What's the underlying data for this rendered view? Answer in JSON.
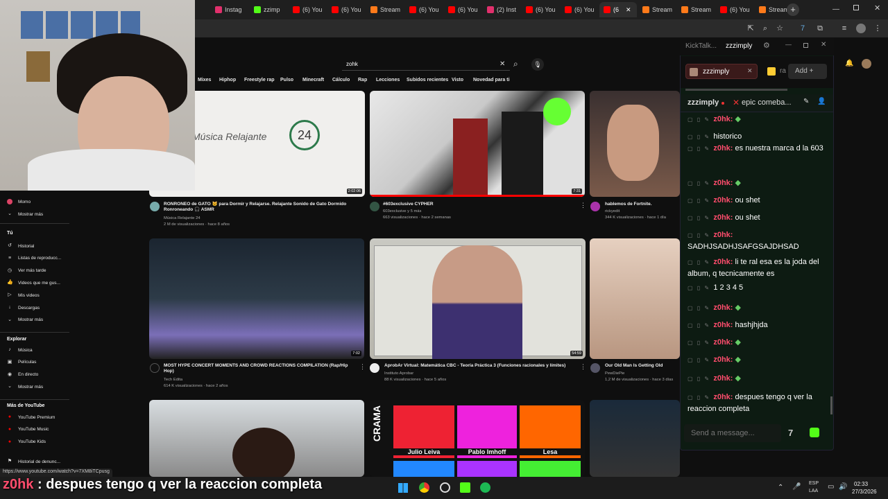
{
  "browser": {
    "tabs": [
      {
        "label": "Instag",
        "color": "#e1306c"
      },
      {
        "label": "zzimp",
        "color": "#53fc18"
      },
      {
        "label": "(6) You",
        "color": "#ff0000"
      },
      {
        "label": "(6) You",
        "color": "#ff0000"
      },
      {
        "label": "Stream",
        "color": "#ff7a1a"
      },
      {
        "label": "(6) You",
        "color": "#ff0000"
      },
      {
        "label": "(6) You",
        "color": "#ff0000"
      },
      {
        "label": "(2) Inst",
        "color": "#e1306c"
      },
      {
        "label": "(6) You",
        "color": "#ff0000"
      },
      {
        "label": "(6) You",
        "color": "#ff0000"
      },
      {
        "label": "(6",
        "color": "#ff0000",
        "active": true
      },
      {
        "label": "Stream",
        "color": "#ff7a1a"
      },
      {
        "label": "Stream",
        "color": "#ff7a1a"
      },
      {
        "label": "(6) You",
        "color": "#ff0000"
      },
      {
        "label": "Stream",
        "color": "#ff7a1a"
      }
    ]
  },
  "youtube": {
    "search_value": "zohk",
    "chips": [
      "Mixes",
      "Hiphop",
      "Freestyle rap",
      "Pulso",
      "Minecraft",
      "Cálculo",
      "Rap",
      "Lecciones",
      "Subidos recientes",
      "Visto",
      "Novedad para ti"
    ],
    "sidebar": {
      "momo": "Momo",
      "mostrar_mas_1": "Mostrar más",
      "tu_heading": "Tú",
      "tu_items": [
        "Historial",
        "Listas de reproducc...",
        "Ver más tarde",
        "Videos que me gus...",
        "Mis videos",
        "Descargas",
        "Mostrar más"
      ],
      "explorar_heading": "Explorar",
      "explorar_items": [
        "Música",
        "Películas",
        "En directo",
        "Mostrar más"
      ],
      "mas_heading": "Más de YouTube",
      "mas_items": [
        "YouTube Premium",
        "YouTube Music",
        "YouTube Kids"
      ],
      "historial_denuncias": "Historial de denunc..."
    },
    "videos": [
      {
        "title": "RONRONEO de GATO 🐱 para Dormir y Relajarse. Relajante Sonido de Gato Dormido Ronroneando 🎧 ASMR",
        "channel": "Música Relajante 24",
        "meta": "2 M de visualizaciones · hace 8 años",
        "duration": "2:02:06",
        "thumb_text": "Música Relajante",
        "thumb_num": "24"
      },
      {
        "title": "#603exclusive CYPHER",
        "channel": "603exclusive y 5 más",
        "meta": "663 visualizaciones · hace 2 semanas",
        "duration": "7:31"
      },
      {
        "title": "hablemos de Fortnite.",
        "channel": "rickyedit",
        "meta": "344 K visualizaciones · hace 1 día"
      },
      {
        "title": "MOST HYPE CONCERT MOMENTS AND CROWD REACTIONS COMPILATION (Rap/Hip Hop)",
        "channel": "Tech Edita",
        "meta": "614 K visualizaciones · hace 2 años",
        "duration": "7:02"
      },
      {
        "title": "AprobAr Virtual: Matemática CBC - Teoría Práctica 3 (Funciones racionales y límites)",
        "channel": "Instituto Aprobar",
        "meta": "88 K visualizaciones · hace 5 años",
        "duration": "54:59"
      },
      {
        "title": "Our Old Man Is Getting Old",
        "channel": "PewDiePie",
        "meta": "1,2 M de visualizaciones · hace 3 días"
      }
    ],
    "row3_names": [
      "Julio Leiva",
      "Pablo Imhoff",
      "Lesa"
    ],
    "row3_side_text": "CRAMA",
    "status_url": "https://www.youtube.com/watch?v=7XM8iTCpusg"
  },
  "kick": {
    "app_name": "KickTalk...",
    "channel_tab": "zzzimply",
    "tab_user": "zzzimply",
    "tab_second": "ra",
    "add_label": "Add",
    "header_user": "zzzimply",
    "header_title": "epic comeba...",
    "messages": [
      {
        "user": "z0hk:",
        "text": ""
      },
      {
        "user": "",
        "text": "historico"
      },
      {
        "user": "z0hk:",
        "text": "es nuestra marca d la 603"
      },
      {
        "user": "z0hk:",
        "text": ""
      },
      {
        "user": "z0hk:",
        "text": "ou shet"
      },
      {
        "user": "z0hk:",
        "text": "ou shet"
      },
      {
        "user": "z0hk:",
        "text": "SADHJSADHJSAFGSAJDHSAD"
      },
      {
        "user": "z0hk:",
        "text": "li te ral esa es la joda del album, q tecnicamente es"
      },
      {
        "user": "",
        "text": "1  2  3  4  5"
      },
      {
        "user": "z0hk:",
        "text": ""
      },
      {
        "user": "z0hk:",
        "text": "hashjhjda"
      },
      {
        "user": "z0hk:",
        "text": ""
      },
      {
        "user": "z0hk:",
        "text": ""
      },
      {
        "user": "z0hk:",
        "text": ""
      },
      {
        "user": "z0hk:",
        "text": "despues tengo q ver la reaccion completa"
      }
    ],
    "input_placeholder": "Send a message..."
  },
  "overlay": {
    "user": "z0hk",
    "text": " : despues tengo q ver la reaccion completa"
  },
  "taskbar": {
    "lang_top": "ESP",
    "lang_bottom": "LAA",
    "time": "02:33",
    "date": "27/3/2026"
  },
  "colors": {
    "kick_green": "#53fc18",
    "yt_red": "#ff0000",
    "chat_user": "#ff4d6d"
  }
}
